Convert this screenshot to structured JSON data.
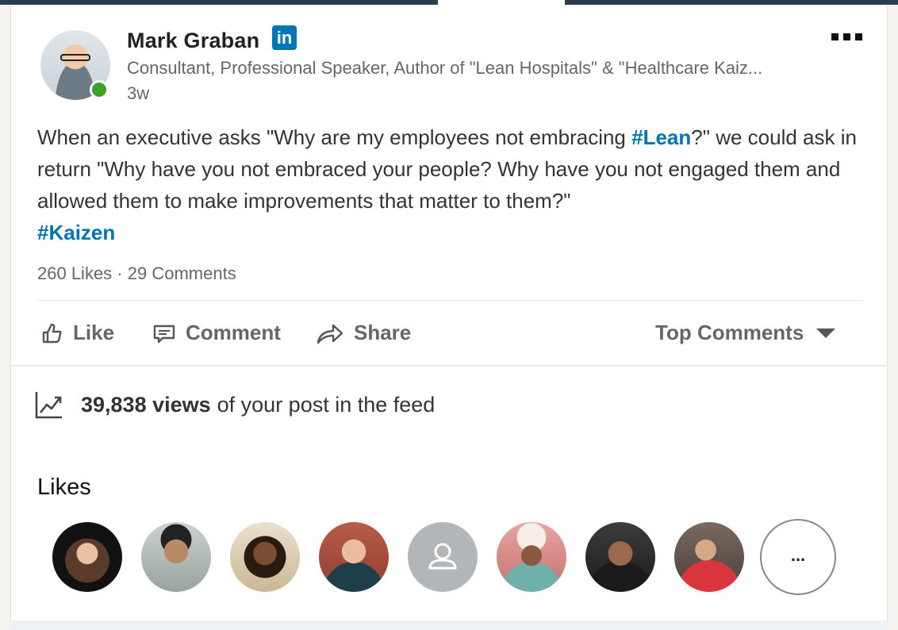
{
  "post": {
    "author": {
      "name": "Mark Graban",
      "badge_text": "in",
      "headline": "Consultant, Professional Speaker, Author of \"Lean Hospitals\" & \"Healthcare Kaiz...",
      "time": "3w",
      "online": true
    },
    "text": {
      "part1": "When an executive asks \"Why are my employees not embracing ",
      "hashtag1": "#Lean",
      "part2": "?\" we could ask in return \"Why have you not embraced your people? Why have you not engaged them and allowed them to make improvements that matter to them?\"",
      "hashtag2": "#Kaizen"
    },
    "counts": {
      "likes": "260 Likes",
      "separator": "·",
      "comments": "29 Comments"
    },
    "actions": {
      "like": "Like",
      "comment": "Comment",
      "share": "Share",
      "sort": "Top Comments"
    },
    "views": {
      "count": "39,838 views",
      "suffix": "of your post in the feed"
    },
    "likes_section": {
      "heading": "Likes",
      "more_label": "..."
    }
  },
  "icons": {
    "more": "more-horizontal-icon",
    "like": "thumbs-up-icon",
    "comment": "comment-icon",
    "share": "share-arrow-icon",
    "views": "trending-chart-icon",
    "caret": "caret-down-icon",
    "placeholder_avatar": "person-placeholder-icon"
  },
  "colors": {
    "brand": "#0077b5",
    "hashtag": "#0073b1",
    "online": "#3ea12a",
    "header_bar": "#283e4a"
  }
}
